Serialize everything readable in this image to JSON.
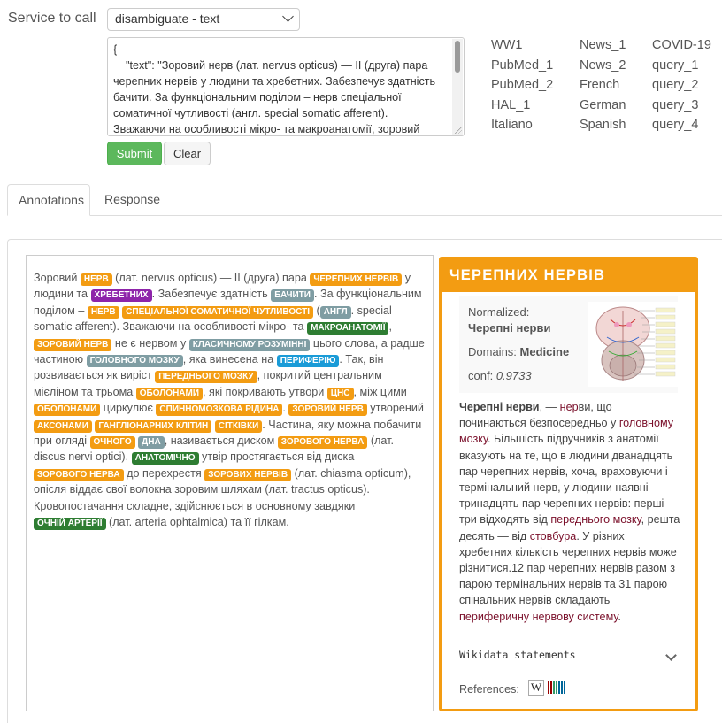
{
  "service": {
    "label": "Service to call",
    "selected": "disambiguate - text"
  },
  "request": {
    "lines": [
      "{",
      "    \"text\": \"Зоровий нерв (лат. nervus opticus) — II (друга) пара",
      "черепних нервів у людини та хребетних. Забезпечує здатність",
      "бачити. За функціональним поділом – нерв спеціальної",
      "соматичної чутливості (англ. special somatic afferent).",
      "Зважаючи на особливості мікро- та макроанатомії, зоровий"
    ]
  },
  "buttons": {
    "submit": "Submit",
    "clear": "Clear"
  },
  "examples": {
    "col1": [
      "WW1",
      "PubMed_1",
      "PubMed_2",
      "HAL_1",
      "Italiano"
    ],
    "col2": [
      "News_1",
      "News_2",
      "French",
      "German",
      "Spanish"
    ],
    "col3": [
      "COVID-19",
      "query_1",
      "query_2",
      "query_3",
      "query_4"
    ]
  },
  "tabs": {
    "annotations": "Annotations",
    "response": "Response"
  },
  "annotated_text": [
    [
      [
        "t",
        "Зоровий "
      ],
      [
        "o",
        "НЕРВ"
      ],
      [
        "t",
        " (лат. nervus opticus) — II (друга) пара "
      ],
      [
        "o",
        "ЧЕРЕПНИХ НЕРВІВ"
      ],
      [
        "t",
        " у"
      ]
    ],
    [
      [
        "t",
        "людини та "
      ],
      [
        "p",
        "ХРЕБЕТНИХ"
      ],
      [
        "t",
        ". Забезпечує здатність "
      ],
      [
        "g",
        "БАЧИТИ"
      ],
      [
        "t",
        ". За"
      ]
    ],
    [
      [
        "t",
        "функціональним поділом – "
      ],
      [
        "o",
        "НЕРВ"
      ],
      [
        "t",
        " "
      ],
      [
        "o",
        "СПЕЦІАЛЬНОЇ СОМАТИЧНОЇ ЧУТЛИВОСТІ"
      ]
    ],
    [
      [
        "t",
        "("
      ],
      [
        "g",
        "АНГЛ"
      ],
      [
        "t",
        ". special somatic afferent). Зважаючи на особливості мікро- та"
      ]
    ],
    [
      [
        "gr",
        "МАКРОАНАТОМІЇ"
      ],
      [
        "t",
        ", "
      ],
      [
        "o",
        "ЗОРОВИЙ НЕРВ"
      ],
      [
        "t",
        " не є нервом у "
      ],
      [
        "g",
        "КЛАСИЧНОМУ РОЗУМІННІ"
      ]
    ],
    [
      [
        "t",
        "цього слова, а радше частиною "
      ],
      [
        "g",
        "ГОЛОВНОГО МОЗКУ"
      ],
      [
        "t",
        ", яка винесена на"
      ]
    ],
    [
      [
        "b",
        "ПЕРИФЕРІЮ"
      ],
      [
        "t",
        ". Так, він розвивається як виріст "
      ],
      [
        "o",
        "ПЕРЕДНЬОГО МОЗКУ"
      ],
      [
        "t",
        ", покритий"
      ]
    ],
    [
      [
        "t",
        "центральним мієліном та трьома "
      ],
      [
        "o",
        "ОБОЛОНАМИ"
      ],
      [
        "t",
        ", які покривають утвори"
      ]
    ],
    [
      [
        "o",
        "ЦНС"
      ],
      [
        "t",
        ", між цими "
      ],
      [
        "o",
        "ОБОЛОНАМИ"
      ],
      [
        "t",
        " циркулює "
      ],
      [
        "o",
        "СПИННОМОЗКОВА РІДИНА"
      ],
      [
        "t",
        "."
      ]
    ],
    [
      [
        "o",
        "ЗОРОВИЙ НЕРВ"
      ],
      [
        "t",
        " утворений "
      ],
      [
        "o",
        "АКСОНАМИ"
      ],
      [
        "t",
        " "
      ],
      [
        "o",
        "ГАНГЛІОНАРНИХ КЛІТИН"
      ],
      [
        "t",
        " "
      ],
      [
        "o",
        "СІТКІВКИ"
      ],
      [
        "t",
        "."
      ]
    ],
    [
      [
        "t",
        "Частина, яку можна побачити при огляді "
      ],
      [
        "o",
        "ОЧНОГО"
      ],
      [
        "t",
        " "
      ],
      [
        "g",
        "ДНА"
      ],
      [
        "t",
        ", називається"
      ]
    ],
    [
      [
        "t",
        "диском "
      ],
      [
        "o",
        "ЗОРОВОГО НЕРВА"
      ],
      [
        "t",
        " (лат. discus nervi optici). "
      ],
      [
        "gr",
        "АНАТОМІЧНО"
      ],
      [
        "t",
        " утвір"
      ]
    ],
    [
      [
        "t",
        "простягається від диска "
      ],
      [
        "o",
        "ЗОРОВОГО НЕРВА"
      ],
      [
        "t",
        " до перехрестя "
      ],
      [
        "o",
        "ЗОРОВИХ НЕРВІВ"
      ]
    ],
    [
      [
        "t",
        "(лат. chiasma opticum), опісля віддає свої волокна зоровим шляхам (лат."
      ]
    ],
    [
      [
        "t",
        "tractus opticus). Кровопостачання складне, здійснюється в основному"
      ]
    ],
    [
      [
        "t",
        "завдяки "
      ],
      [
        "gr",
        "ОЧНІЙ АРТЕРІЇ"
      ],
      [
        "t",
        " (лат. arteria ophtalmica) та її гілкам."
      ]
    ]
  ],
  "info": {
    "title": "ЧЕРЕПНИХ НЕРВІВ",
    "normalized_label": "Normalized:",
    "normalized_value": "Черепні нерви",
    "domains_label": "Domains:",
    "domains_value": "Medicine",
    "conf_label": "conf:",
    "conf_value": "0.9733",
    "description": [
      [
        "b",
        "Черепні нерви"
      ],
      [
        "t",
        ",   — "
      ],
      [
        "l",
        "нер"
      ],
      [
        "t",
        "ви, що починаються безпосередньо у "
      ],
      [
        "l",
        "головному мозку"
      ],
      [
        "t",
        ". Більшість підручників з анатомії вказують на те, що в людини дванадцять пар черепних нервів, хоча, враховуючи і термінальний нерв, у людини наявні тринадцять пар черепних нервів: перші три відходять від "
      ],
      [
        "l",
        "переднього мозку"
      ],
      [
        "t",
        ", решта десять   — від "
      ],
      [
        "l",
        "стовбура"
      ],
      [
        "t",
        ". У різних хребетних кількість черепних нервів може різнитися.12 пар черепних нервів разом з парою термінальних нервів та 31 парою спінальних нервів складають "
      ],
      [
        "l",
        "периферичну нервову систему"
      ],
      [
        "t",
        "."
      ]
    ],
    "wikidata_label": "Wikidata statements",
    "references_label": "References:",
    "wiki_icon": "W"
  }
}
